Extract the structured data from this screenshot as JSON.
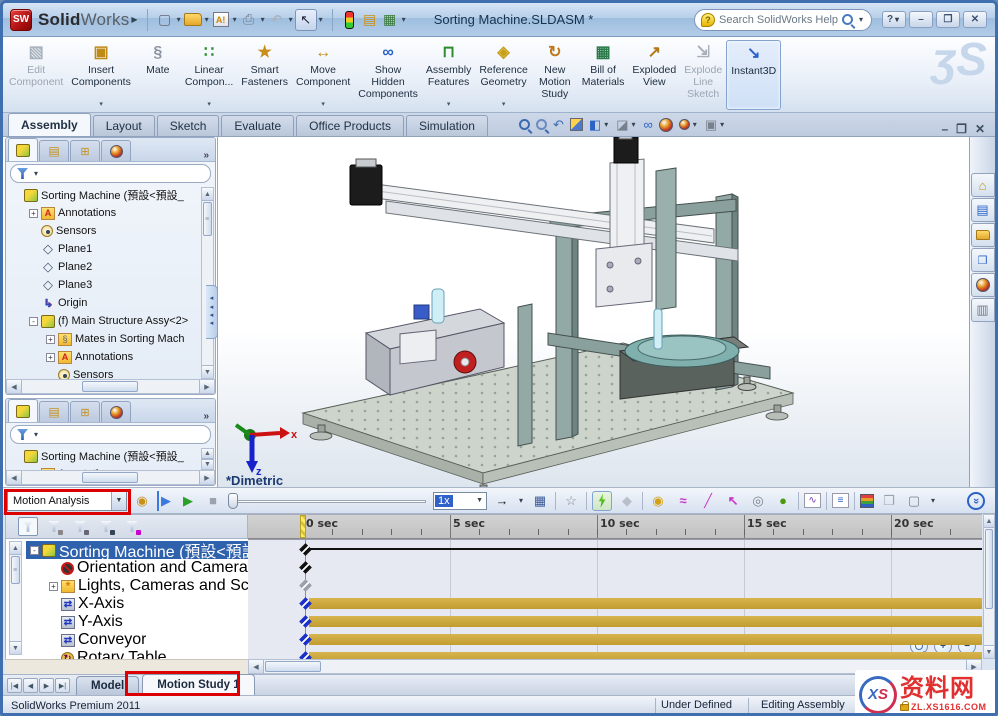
{
  "window": {
    "brand_bold": "Solid",
    "brand_light": "Works",
    "title": "Sorting Machine.SLDASM *",
    "search_placeholder": "Search SolidWorks Help",
    "help_label": "?",
    "minimize_label": "–",
    "maximize_label": "❐",
    "close_label": "✕"
  },
  "command_manager": {
    "buttons": [
      {
        "label": "Edit\nComponent",
        "icon": "edit-component",
        "disabled": true
      },
      {
        "label": "Insert\nComponents",
        "icon": "insert-components",
        "dropdown": true
      },
      {
        "label": "Mate",
        "icon": "mate"
      },
      {
        "label": "Linear\nCompon...",
        "icon": "linear-components",
        "dropdown": true
      },
      {
        "label": "Smart\nFasteners",
        "icon": "smart-fasteners"
      },
      {
        "label": "Move\nComponent",
        "icon": "move-component",
        "dropdown": true
      },
      {
        "label": "Show\nHidden\nComponents",
        "icon": "show-hidden"
      },
      {
        "label": "Assembly\nFeatures",
        "icon": "assembly-features",
        "dropdown": true
      },
      {
        "label": "Reference\nGeometry",
        "icon": "reference-geometry",
        "dropdown": true
      },
      {
        "label": "New\nMotion\nStudy",
        "icon": "new-motion-study"
      },
      {
        "label": "Bill of\nMaterials",
        "icon": "bom"
      },
      {
        "label": "Exploded\nView",
        "icon": "exploded-view"
      },
      {
        "label": "Explode\nLine\nSketch",
        "icon": "explode-line",
        "disabled": true
      },
      {
        "label": "Instant3D",
        "icon": "instant3d",
        "active": true
      }
    ]
  },
  "ribbon_tabs": {
    "items": [
      {
        "label": "Assembly",
        "active": true
      },
      {
        "label": "Layout"
      },
      {
        "label": "Sketch"
      },
      {
        "label": "Evaluate"
      },
      {
        "label": "Office Products"
      },
      {
        "label": "Simulation"
      }
    ]
  },
  "feature_tree_top": {
    "items": [
      {
        "label": "Sorting Machine (預設<預設_",
        "icon": "assembly",
        "indent": 0
      },
      {
        "label": "Annotations",
        "icon": "annotations",
        "expand": "+",
        "indent": 1
      },
      {
        "label": "Sensors",
        "icon": "sensors",
        "indent": 1
      },
      {
        "label": "Plane1",
        "icon": "plane",
        "indent": 1
      },
      {
        "label": "Plane2",
        "icon": "plane",
        "indent": 1
      },
      {
        "label": "Plane3",
        "icon": "plane",
        "indent": 1
      },
      {
        "label": "Origin",
        "icon": "origin",
        "indent": 1
      },
      {
        "label": "(f) Main Structure Assy<2>",
        "icon": "assembly",
        "expand": "-",
        "indent": 1
      },
      {
        "label": "Mates in Sorting Mach",
        "icon": "mates",
        "expand": "+",
        "indent": 2
      },
      {
        "label": "Annotations",
        "icon": "annotations",
        "expand": "+",
        "indent": 2
      },
      {
        "label": "Sensors",
        "icon": "sensors",
        "indent": 2
      }
    ]
  },
  "feature_tree_bottom": {
    "items": [
      {
        "label": "Sorting Machine (預設<預設_",
        "icon": "assembly",
        "indent": 0
      },
      {
        "label": "Annotations",
        "icon": "annotations",
        "expand": "+",
        "indent": 1
      }
    ]
  },
  "viewport": {
    "view_label": "*Dimetric",
    "axis_x_label": "x",
    "axis_z_label": "z"
  },
  "motion": {
    "study_type_value": "Motion Analysis",
    "speed_value": "1x",
    "timeline": {
      "ticks": [
        "0 sec",
        "5 sec",
        "10 sec",
        "15 sec",
        "20 sec"
      ],
      "seconds_per_major": 5
    },
    "tree": {
      "items": [
        {
          "label": "Sorting Machine (預設<預設_顯",
          "icon": "assembly",
          "expand": "-",
          "indent": 0,
          "selected": true
        },
        {
          "label": "Orientation and Camera Viev",
          "icon": "no-camera",
          "indent": 1
        },
        {
          "label": "Lights, Cameras and Scene",
          "icon": "lights",
          "expand": "+",
          "indent": 1
        },
        {
          "label": "X-Axis",
          "icon": "linear-motor",
          "indent": 1
        },
        {
          "label": "Y-Axis",
          "icon": "linear-motor",
          "indent": 1
        },
        {
          "label": "Conveyor",
          "icon": "linear-motor",
          "indent": 1
        },
        {
          "label": "Rotary Table",
          "icon": "rotary-motor",
          "indent": 1
        }
      ]
    },
    "rows": [
      {
        "kind": "line",
        "key": "black"
      },
      {
        "kind": "key",
        "key": "black"
      },
      {
        "kind": "key",
        "key": "muted"
      },
      {
        "kind": "bar",
        "key": "blue"
      },
      {
        "kind": "bar",
        "key": "blue"
      },
      {
        "kind": "bar",
        "key": "blue"
      },
      {
        "kind": "bar",
        "key": "blue"
      }
    ]
  },
  "bottom_bar": {
    "model_tab": "Model",
    "motion_tab": "Motion Study 1"
  },
  "status": {
    "app": "SolidWorks Premium 2011",
    "define_state": "Under Defined",
    "mode": "Editing Assembly"
  },
  "watermark": {
    "logo_x": "X",
    "logo_s": "S",
    "site_name": "资料网",
    "site_url": "ZL.XS1616.COM"
  }
}
